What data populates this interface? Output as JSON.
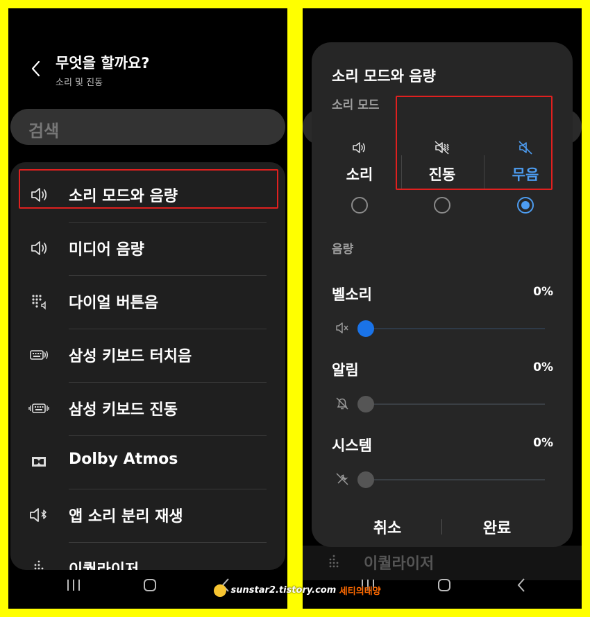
{
  "left": {
    "header": {
      "title": "무엇을 할까요?",
      "subtitle": "소리 및 진동"
    },
    "search": {
      "label": "검색"
    },
    "menu": [
      {
        "label": "소리 모드와 음량",
        "icon": "speaker-icon"
      },
      {
        "label": "미디어 음량",
        "icon": "speaker-icon"
      },
      {
        "label": "다이얼 버튼음",
        "icon": "dialpad-sound-icon"
      },
      {
        "label": "삼성 키보드 터치음",
        "icon": "keyboard-sound-icon"
      },
      {
        "label": "삼성 키보드 진동",
        "icon": "keyboard-vibrate-icon"
      },
      {
        "label": "Dolby Atmos",
        "icon": "dolby-icon"
      },
      {
        "label": "앱 소리 분리 재생",
        "icon": "bluetooth-sound-icon"
      },
      {
        "label": "이퀄라이저",
        "icon": "equalizer-icon"
      }
    ],
    "highlighted_item": "소리 모드와 음량"
  },
  "right": {
    "background_item": {
      "label": "이퀄라이저"
    },
    "dialog": {
      "title": "소리 모드와 음량",
      "mode_section_label": "소리 모드",
      "modes": [
        {
          "label": "소리",
          "icon": "sound-icon",
          "selected": false
        },
        {
          "label": "진동",
          "icon": "vibrate-icon",
          "selected": false
        },
        {
          "label": "무음",
          "icon": "mute-icon",
          "selected": true
        }
      ],
      "volume_section_label": "음량",
      "volumes": [
        {
          "label": "벨소리",
          "value": "0%",
          "level": 0,
          "icon": "ringtone-muted-icon"
        },
        {
          "label": "알림",
          "value": "0%",
          "level": 0,
          "icon": "notification-muted-icon"
        },
        {
          "label": "시스템",
          "value": "0%",
          "level": 0,
          "icon": "system-muted-icon"
        }
      ],
      "cancel_label": "취소",
      "done_label": "완료"
    }
  },
  "watermark": {
    "url": "sunstar2.tistory.com",
    "name": "세티의태양"
  },
  "colors": {
    "accent": "#4d9cf0",
    "highlight_border": "#e0201f",
    "frame": "#ffff00",
    "dialog_bg": "#262626"
  }
}
